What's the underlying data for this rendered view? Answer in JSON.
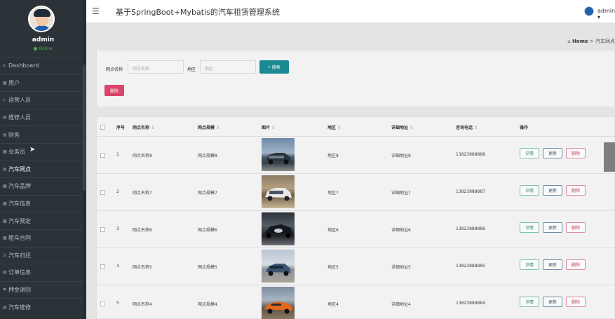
{
  "sidebar": {
    "username": "admin",
    "status": "Online",
    "items": [
      {
        "label": "Dashboard",
        "icon": "home-icon"
      },
      {
        "label": "用户",
        "icon": "grid-icon"
      },
      {
        "label": "运营人员",
        "icon": "tag-icon"
      },
      {
        "label": "维修人员",
        "icon": "list-icon"
      },
      {
        "label": "财务",
        "icon": "list-icon"
      },
      {
        "label": "业务员",
        "icon": "grid-icon"
      },
      {
        "label": "汽车网点",
        "icon": "list-icon"
      },
      {
        "label": "汽车品牌",
        "icon": "grid-icon"
      },
      {
        "label": "汽车信息",
        "icon": "grid-icon"
      },
      {
        "label": "汽车预定",
        "icon": "grid-icon"
      },
      {
        "label": "租车合同",
        "icon": "grid-icon"
      },
      {
        "label": "汽车归还",
        "icon": "user-icon"
      },
      {
        "label": "订单信息",
        "icon": "list-icon"
      },
      {
        "label": "押金退回",
        "icon": "flag-icon"
      },
      {
        "label": "汽车维修",
        "icon": "list-icon"
      }
    ]
  },
  "topbar": {
    "title": "基于SpringBoot+Mybatis的汽车租赁管理系统",
    "user": "admin"
  },
  "breadcrumb": {
    "home": "Home",
    "separator": ">",
    "current": "汽车网点"
  },
  "search": {
    "name_label": "网点名称",
    "name_placeholder": "网点名称",
    "region_label": "地区",
    "region_placeholder": "地区",
    "search_button": "搜索",
    "delete_button": "删除"
  },
  "table": {
    "headers": {
      "index": "序号",
      "name": "网点名称",
      "scale": "网点规模",
      "image": "图片",
      "region": "地区",
      "address": "详细地址",
      "phone": "咨询电话",
      "action": "操作"
    },
    "sort_icon": "⇕",
    "rows": [
      {
        "index": "1",
        "name": "网点名称8",
        "scale": "网点规模8",
        "region": "地区8",
        "address": "详细地址8",
        "phone": "13823888888",
        "car": "car-silver-suv"
      },
      {
        "index": "2",
        "name": "网点名称7",
        "scale": "网点规模7",
        "region": "地区7",
        "address": "详细地址7",
        "phone": "13823888887",
        "car": "car-white-suv"
      },
      {
        "index": "3",
        "name": "网点名称6",
        "scale": "网点规模6",
        "region": "地区6",
        "address": "详细地址6",
        "phone": "13823888886",
        "car": "car-dark-sedan"
      },
      {
        "index": "4",
        "name": "网点名称5",
        "scale": "网点规模5",
        "region": "地区5",
        "address": "详细地址5",
        "phone": "13823888885",
        "car": "car-blue-suv"
      },
      {
        "index": "5",
        "name": "网点名称4",
        "scale": "网点规模4",
        "region": "地区4",
        "address": "详细地址4",
        "phone": "13823888884",
        "car": "car-orange-sports"
      }
    ],
    "actions": {
      "detail": "详情",
      "update": "更新",
      "remove": "删除"
    }
  },
  "colors": {
    "sidebar_bg": "#2c3338",
    "search_button": "#1a8a92",
    "delete_button": "#d9456c",
    "online": "#4cae4c"
  }
}
